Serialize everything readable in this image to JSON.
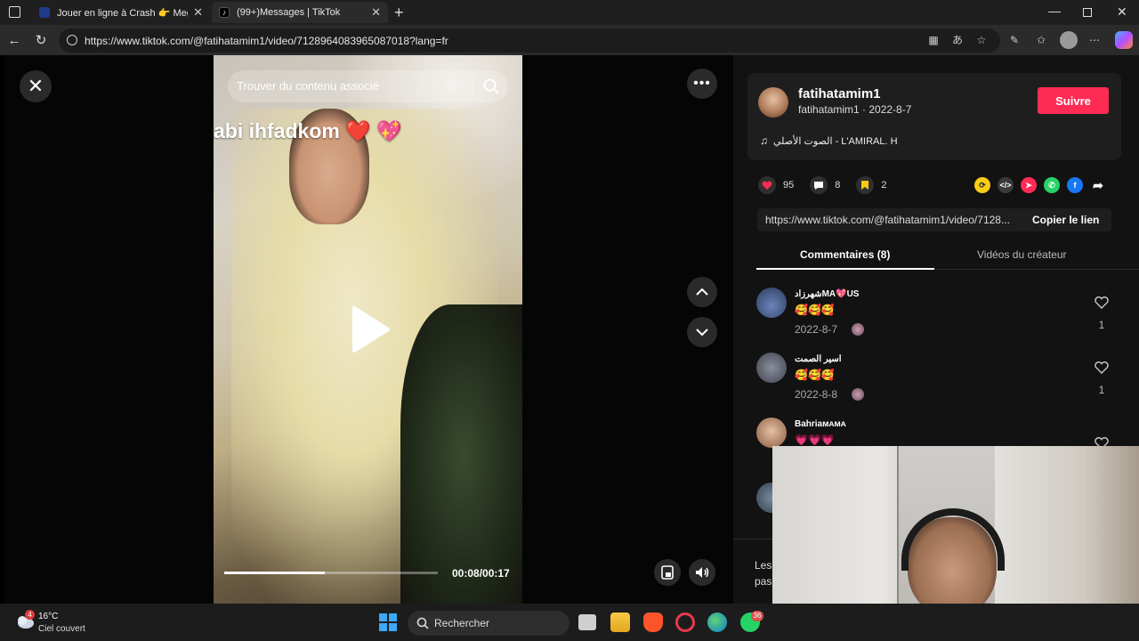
{
  "browser": {
    "tabs": [
      {
        "label": "Jouer en ligne à Crash 👉 Megap",
        "active": false
      },
      {
        "label": "(99+)Messages | TikTok",
        "active": true
      }
    ],
    "url": "https://www.tiktok.com/@fatihatamim1/video/7128964083965087018?lang=fr"
  },
  "video": {
    "search_placeholder": "Trouver du contenu associé",
    "caption_overlay": "abi ihfadkom ❤️ 💖",
    "time": "00:08/00:17",
    "progress": 0.47
  },
  "author": {
    "name": "fatihatamim1",
    "handle_date": "fatihatamim1 · 2022-8-7",
    "follow_label": "Suivre",
    "music": "الصوت الأصلي - L'AMIRAL. H"
  },
  "stats": {
    "likes": "95",
    "comments": "8",
    "saves": "2"
  },
  "link": {
    "url": "https://www.tiktok.com/@fatihatamim1/video/7128...",
    "copy_label": "Copier le lien"
  },
  "panel_tabs": {
    "comments": "Commentaires (8)",
    "creator": "Vidéos du créateur"
  },
  "comments": [
    {
      "name": "شهرزادMA💖US",
      "text": "🥰🥰🥰",
      "date": "2022-8-7",
      "likes": "1"
    },
    {
      "name": "اسير الصمت",
      "text": "🥰🥰🥰",
      "date": "2022-8-8",
      "likes": "1"
    },
    {
      "name": "Bahriaᴍᴀᴍᴀ",
      "text": "💗💗💗",
      "date": "",
      "likes": ""
    }
  ],
  "bottom_text": "Les pas",
  "taskbar": {
    "weather_badge": "4",
    "temperature": "16°C",
    "weather_desc": "Ciel couvert",
    "search_label": "Rechercher",
    "whatsapp_badge": "36"
  },
  "colors": {
    "accent": "#fe2c55",
    "panel_bg": "#121212"
  }
}
